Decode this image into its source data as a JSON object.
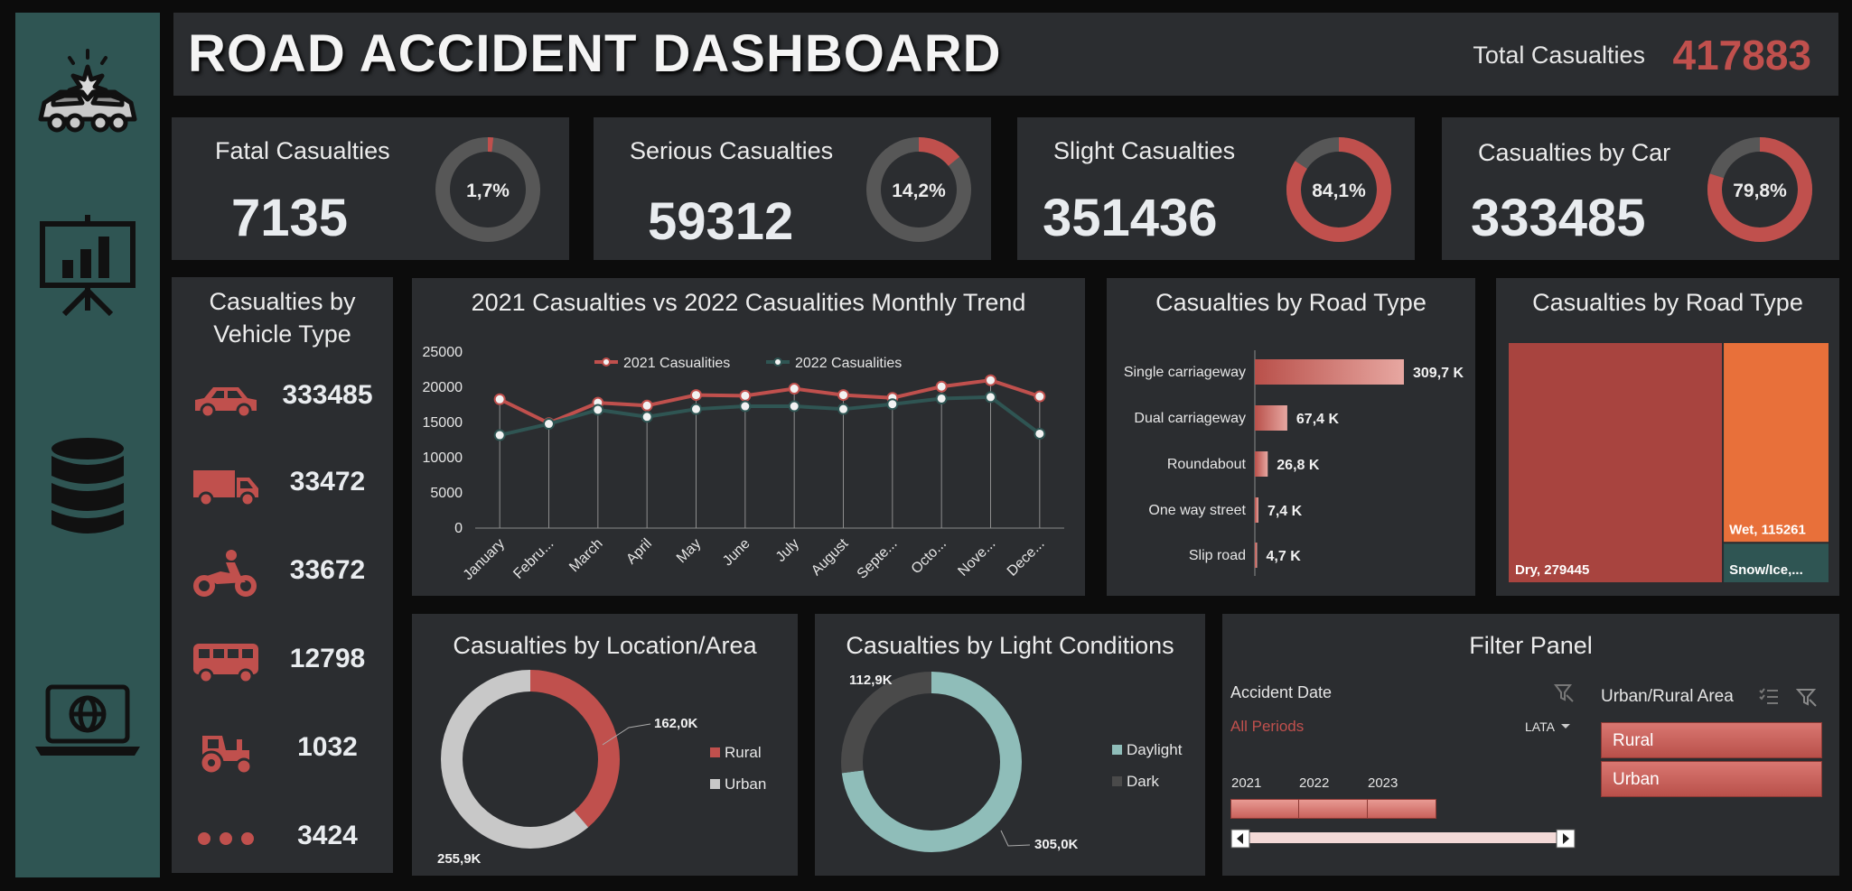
{
  "header": {
    "title": "ROAD ACCIDENT DASHBOARD",
    "total_label": "Total Casualties",
    "total_value": "417883"
  },
  "sidebar": {
    "icons": [
      "car-crash-icon",
      "presentation-chart-icon",
      "database-icon",
      "laptop-globe-icon"
    ]
  },
  "kpis": [
    {
      "label": "Fatal Casualties",
      "value": "7135",
      "percent_label": "1,7%",
      "percent": 1.7
    },
    {
      "label": "Serious Casualties",
      "value": "59312",
      "percent_label": "14,2%",
      "percent": 14.2
    },
    {
      "label": "Slight Casualties",
      "value": "351436",
      "percent_label": "84,1%",
      "percent": 84.1
    },
    {
      "label": "Casualties by Car",
      "value": "333485",
      "percent_label": "79,8%",
      "percent": 79.8
    }
  ],
  "vehicle": {
    "title_line1": "Casualties by",
    "title_line2": "Vehicle Type",
    "rows": [
      {
        "icon": "car-icon",
        "value": "333485"
      },
      {
        "icon": "truck-icon",
        "value": "33472"
      },
      {
        "icon": "motorbike-icon",
        "value": "33672"
      },
      {
        "icon": "bus-icon",
        "value": "12798"
      },
      {
        "icon": "tractor-icon",
        "value": "1032"
      },
      {
        "icon": "more-dots-icon",
        "value": "3424"
      }
    ]
  },
  "colors": {
    "accent_red": "#c0504d",
    "accent_teal": "#2f5553",
    "panel": "#2b2d30",
    "orange": "#e8703a"
  },
  "charts": {
    "trend": {
      "title": "2021 Casualties vs 2022 Casualities Monthly Trend",
      "chart_data": {
        "type": "line",
        "x_labels": [
          "January",
          "Febru...",
          "March",
          "April",
          "May",
          "June",
          "July",
          "August",
          "Septe...",
          "Octo...",
          "Nove...",
          "Dece..."
        ],
        "y_ticks": [
          "0",
          "5000",
          "10000",
          "15000",
          "20000",
          "25000"
        ],
        "ylim": [
          0,
          25000
        ],
        "series": [
          {
            "name": "2021 Casualities",
            "color": "#c0504d",
            "values": [
              18300,
              14900,
              17800,
              17400,
              18900,
              18800,
              19800,
              18900,
              18500,
              20100,
              21000,
              18700
            ]
          },
          {
            "name": "2022 Casualities",
            "color": "#2f5553",
            "values": [
              13200,
              14800,
              16800,
              15800,
              16900,
              17300,
              17300,
              16900,
              17600,
              18400,
              18600,
              13400
            ]
          }
        ],
        "legend": "top"
      }
    },
    "road_type_bar": {
      "title": "Casualties by Road Type",
      "chart_data": {
        "type": "bar",
        "orientation": "horizontal",
        "categories": [
          "Single carriageway",
          "Dual carriageway",
          "Roundabout",
          "One way street",
          "Slip road"
        ],
        "values": [
          309.7,
          67.4,
          26.8,
          7.4,
          4.7
        ],
        "value_labels": [
          "309,7 K",
          "67,4 K",
          "26,8 K",
          "7,4 K",
          "4,7 K"
        ]
      }
    },
    "road_surface_treemap": {
      "title": "Casualties by Road Type",
      "chart_data": {
        "type": "treemap",
        "items": [
          {
            "label": "Dry, 279445",
            "value": 279445,
            "color": "#a8443f"
          },
          {
            "label": "Wet, 115261",
            "value": 115261,
            "color": "#e8703a"
          },
          {
            "label": "Snow/Ice,...",
            "value": 23177,
            "color": "#2f5553"
          }
        ]
      }
    },
    "location": {
      "title": "Casualties by Location/Area",
      "chart_data": {
        "type": "pie",
        "donut": true,
        "slices": [
          {
            "name": "Rural",
            "value": 162.0,
            "label": "162,0K",
            "color": "#c0504d"
          },
          {
            "name": "Urban",
            "value": 255.9,
            "label": "255,9K",
            "color": "#c8c8c8"
          }
        ],
        "legend": "right"
      }
    },
    "light": {
      "title": "Casualties by Light Conditions",
      "chart_data": {
        "type": "pie",
        "donut": true,
        "slices": [
          {
            "name": "Daylight",
            "value": 305.0,
            "label": "305,0K",
            "color": "#8fbdb9"
          },
          {
            "name": "Dark",
            "value": 112.9,
            "label": "112,9K",
            "color": "#4a4a4a"
          }
        ],
        "legend": "right"
      }
    }
  },
  "filter": {
    "title": "Filter Panel",
    "date_label": "Accident Date",
    "period_text": "All Periods",
    "granularity": "LATA",
    "years": [
      "2021",
      "2022",
      "2023"
    ],
    "area_label": "Urban/Rural Area",
    "area_options": [
      "Rural",
      "Urban"
    ]
  }
}
